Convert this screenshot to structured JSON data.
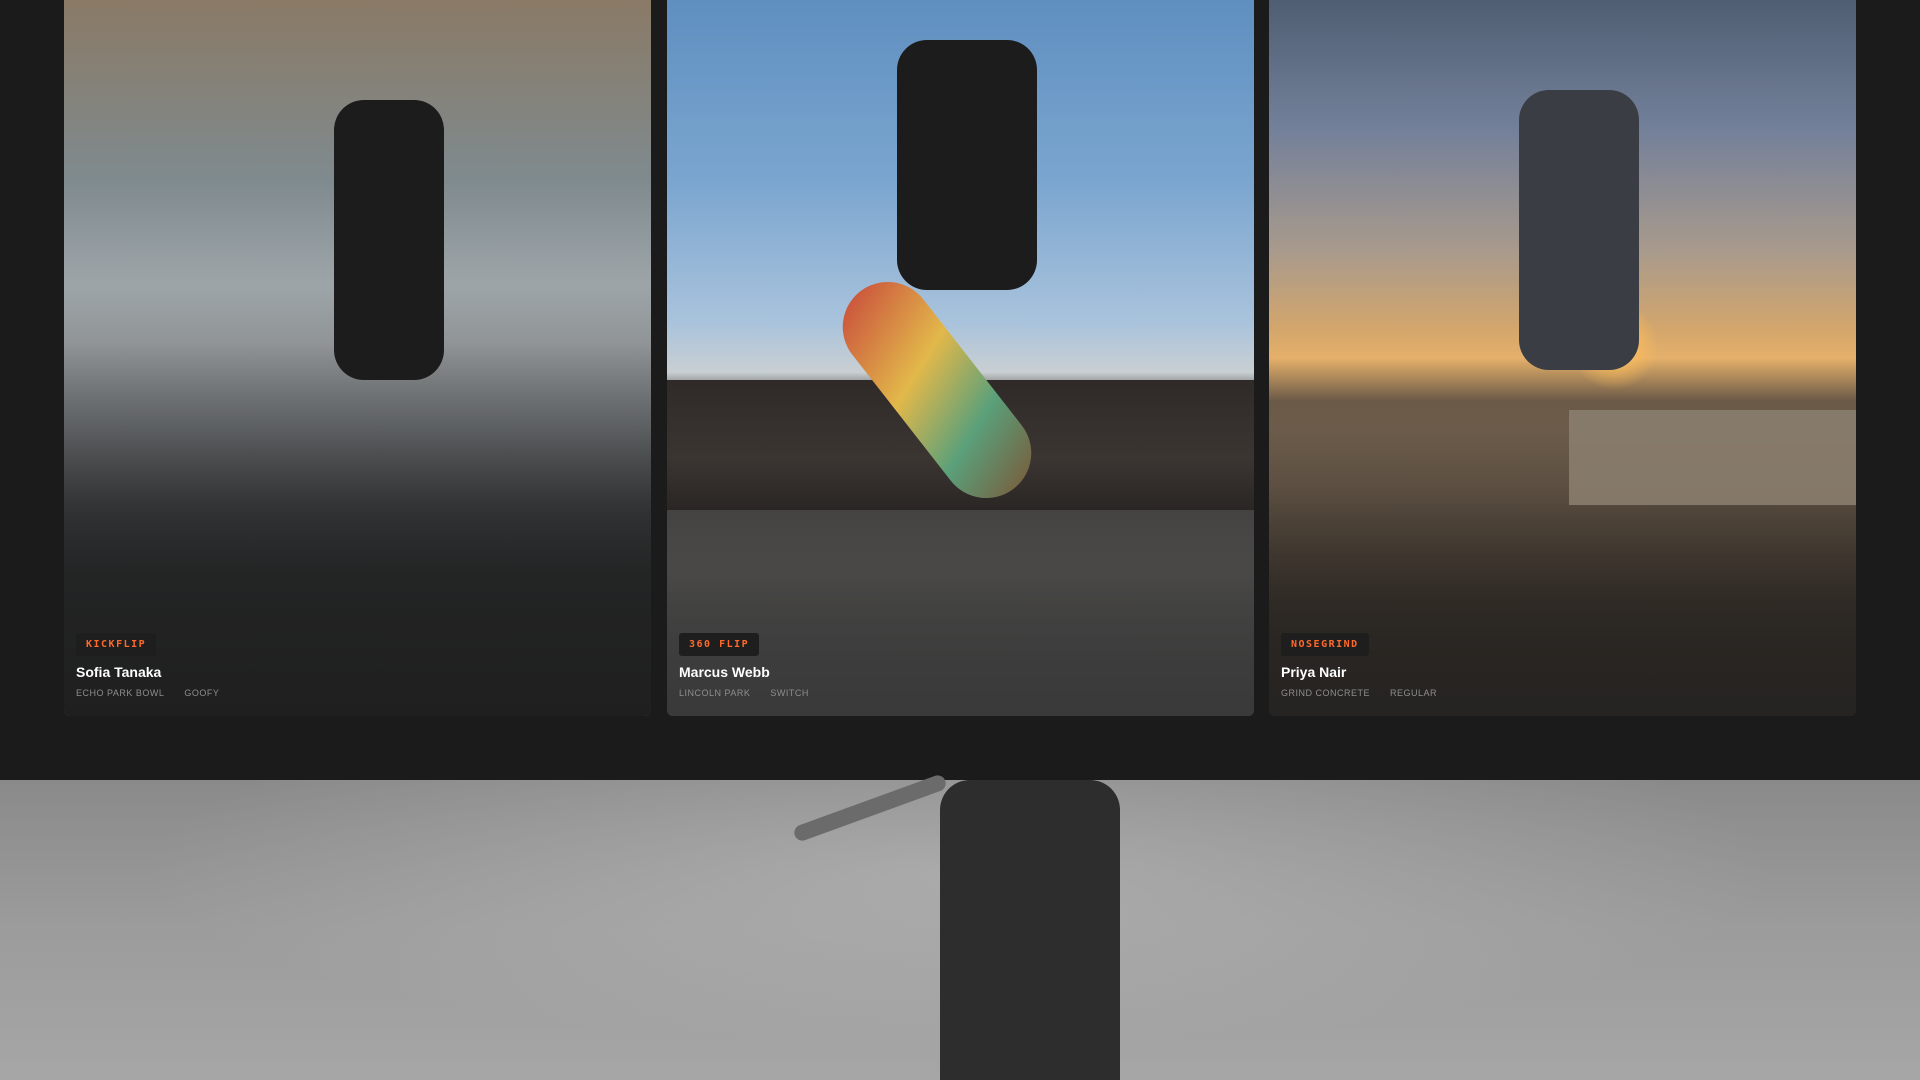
{
  "cards": [
    {
      "trick": "KICKFLIP",
      "name": "Sofia Tanaka",
      "location": "ECHO PARK BOWL",
      "stance": "GOOFY"
    },
    {
      "trick": "360 FLIP",
      "name": "Marcus Webb",
      "location": "LINCOLN PARK",
      "stance": "SWITCH"
    },
    {
      "trick": "NOSEGRIND",
      "name": "Priya Nair",
      "location": "GRIND CONCRETE",
      "stance": "REGULAR"
    }
  ],
  "colors": {
    "accent": "#ff6a2b",
    "background": "#1b1b1b"
  }
}
